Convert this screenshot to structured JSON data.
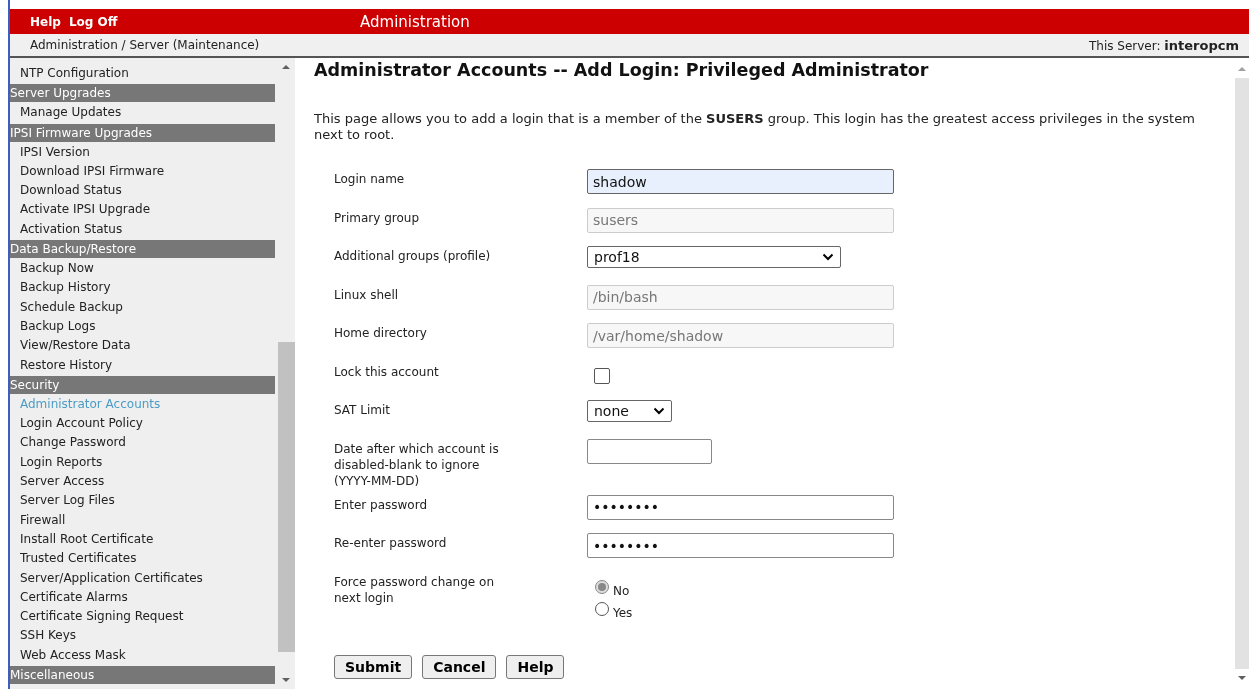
{
  "header": {
    "links": [
      "Help",
      "Log Off"
    ],
    "title": "Administration"
  },
  "breadcrumb": "Administration / Server (Maintenance)",
  "server": {
    "label": "This Server:",
    "name": "interopcm"
  },
  "sidebar": {
    "items": [
      {
        "kind": "item",
        "label": "NTP Configuration",
        "selected": false
      },
      {
        "kind": "header",
        "label": "Server Upgrades"
      },
      {
        "kind": "item",
        "label": "Manage Updates",
        "selected": false
      },
      {
        "kind": "header",
        "label": "IPSI Firmware Upgrades"
      },
      {
        "kind": "item",
        "label": "IPSI Version",
        "selected": false
      },
      {
        "kind": "item",
        "label": "Download IPSI Firmware",
        "selected": false
      },
      {
        "kind": "item",
        "label": "Download Status",
        "selected": false
      },
      {
        "kind": "item",
        "label": "Activate IPSI Upgrade",
        "selected": false
      },
      {
        "kind": "item",
        "label": "Activation Status",
        "selected": false
      },
      {
        "kind": "header",
        "label": "Data Backup/Restore"
      },
      {
        "kind": "item",
        "label": "Backup Now",
        "selected": false
      },
      {
        "kind": "item",
        "label": "Backup History",
        "selected": false
      },
      {
        "kind": "item",
        "label": "Schedule Backup",
        "selected": false
      },
      {
        "kind": "item",
        "label": "Backup Logs",
        "selected": false
      },
      {
        "kind": "item",
        "label": "View/Restore Data",
        "selected": false
      },
      {
        "kind": "item",
        "label": "Restore History",
        "selected": false
      },
      {
        "kind": "header",
        "label": "Security"
      },
      {
        "kind": "item",
        "label": "Administrator Accounts",
        "selected": true
      },
      {
        "kind": "item",
        "label": "Login Account Policy",
        "selected": false
      },
      {
        "kind": "item",
        "label": "Change Password",
        "selected": false
      },
      {
        "kind": "item",
        "label": "Login Reports",
        "selected": false
      },
      {
        "kind": "item",
        "label": "Server Access",
        "selected": false
      },
      {
        "kind": "item",
        "label": "Server Log Files",
        "selected": false
      },
      {
        "kind": "item",
        "label": "Firewall",
        "selected": false
      },
      {
        "kind": "item",
        "label": "Install Root Certificate",
        "selected": false
      },
      {
        "kind": "item",
        "label": "Trusted Certificates",
        "selected": false
      },
      {
        "kind": "item",
        "label": "Server/Application Certificates",
        "selected": false
      },
      {
        "kind": "item",
        "label": "Certificate Alarms",
        "selected": false
      },
      {
        "kind": "item",
        "label": "Certificate Signing Request",
        "selected": false
      },
      {
        "kind": "item",
        "label": "SSH Keys",
        "selected": false
      },
      {
        "kind": "item",
        "label": "Web Access Mask",
        "selected": false
      },
      {
        "kind": "header",
        "label": "Miscellaneous"
      }
    ]
  },
  "page": {
    "title": "Administrator Accounts -- Add Login: Privileged Administrator",
    "intro": "This page allows you to add a login that is a member of the **SUSERS** group. This login has the greatest access privileges in the system next to root."
  },
  "form": {
    "fields": [
      {
        "kind": "text",
        "label": "Login name",
        "value": "shadow",
        "focused": true,
        "disabled": false
      },
      {
        "kind": "text",
        "label": "Primary group",
        "value": "susers",
        "focused": false,
        "disabled": true
      },
      {
        "kind": "select",
        "label": "Additional groups (profile)",
        "value": "prof18"
      },
      {
        "kind": "text",
        "label": "Linux shell",
        "value": "/bin/bash",
        "focused": false,
        "disabled": true
      },
      {
        "kind": "text",
        "label": "Home directory",
        "value": "/var/home/shadow",
        "focused": false,
        "disabled": true
      },
      {
        "kind": "checkbox",
        "label": "Lock this account",
        "checked": false
      },
      {
        "kind": "shortselect",
        "label": "SAT Limit",
        "value": "none"
      },
      {
        "kind": "date",
        "label": "Date after which account is disabled-blank to ignore (YYYY-MM-DD)"
      },
      {
        "kind": "text",
        "label": "Enter password",
        "value": "••••••••",
        "focused": false,
        "disabled": false
      },
      {
        "kind": "text",
        "label": "Re-enter password",
        "value": "••••••••",
        "focused": false,
        "disabled": false
      },
      {
        "kind": "radio",
        "label": "Force password change on next login",
        "options": [
          {
            "label": "No",
            "selected": true
          },
          {
            "label": "Yes",
            "selected": false
          }
        ]
      }
    ],
    "buttons": [
      "Submit",
      "Cancel",
      "Help"
    ]
  }
}
